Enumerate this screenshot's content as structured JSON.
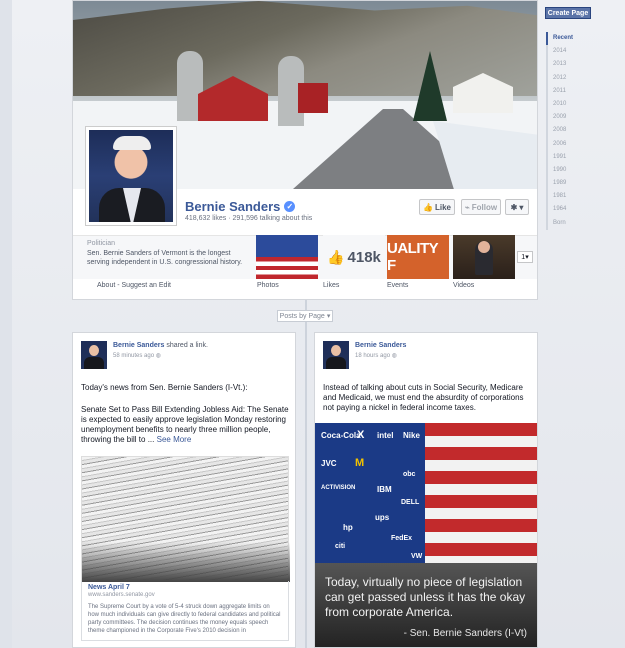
{
  "right_rail": {
    "create_page": "Create Page",
    "years": [
      "Recent",
      "2014",
      "2013",
      "2012",
      "2011",
      "2010",
      "2009",
      "2008",
      "2006",
      "1991",
      "1990",
      "1989",
      "1981",
      "1964",
      "Born"
    ]
  },
  "profile": {
    "name": "Bernie Sanders",
    "stats": "418,632 likes · 291,596 talking about this",
    "like_button": "Like",
    "follow_button": "Follow",
    "category": "Politician",
    "description": "Sen. Bernie Sanders of Vermont is the longest serving independent in U.S. congressional history.",
    "likes_count": "418k",
    "events_tile_text": "UALITY F",
    "apps_count": "1",
    "nav": {
      "about": "About - Suggest an Edit",
      "photos": "Photos",
      "likes": "Likes",
      "events": "Events",
      "videos": "Videos"
    }
  },
  "posts_by": "Posts by Page",
  "posts": [
    {
      "author": "Bernie Sanders",
      "action": "shared a link.",
      "time": "58 minutes ago",
      "text1": "Today's news from Sen. Bernie Sanders (I-Vt.):",
      "text2": "Senate Set to Pass Bill Extending Jobless Aid: The Senate is expected to easily approve legislation Monday restoring unemployment benefits to nearly three million people, throwing the bill to ...",
      "see_more": "See More",
      "link_title": "News April 7",
      "link_domain": "www.sanders.senate.gov",
      "link_desc": "The Supreme Court by a vote of 5-4 struck down aggregate limits on how much individuals can give directly to federal candidates and political party committees. The decision continues the money equals speech theme championed in the Corporate Five's 2010 decision in"
    },
    {
      "author": "Bernie Sanders",
      "time": "18 hours ago",
      "text": "Instead of talking about cuts in Social Security, Medicare and Medicaid, we must end the absurdity of corporations not paying a nickel in federal income taxes.",
      "caption": "Today, virtually no piece of legislation can get passed unless it has the okay from corporate America.",
      "attribution": "- Sen. Bernie Sanders (I-Vt)",
      "logos": [
        "Coca-Cola",
        "X",
        "intel",
        "Nike",
        "JVC",
        "M",
        "Apple",
        "",
        "FedEx",
        "IBM",
        "DELL",
        "ACTIVISION",
        "ups",
        "hp",
        "obc",
        "citi",
        "VW"
      ]
    }
  ]
}
